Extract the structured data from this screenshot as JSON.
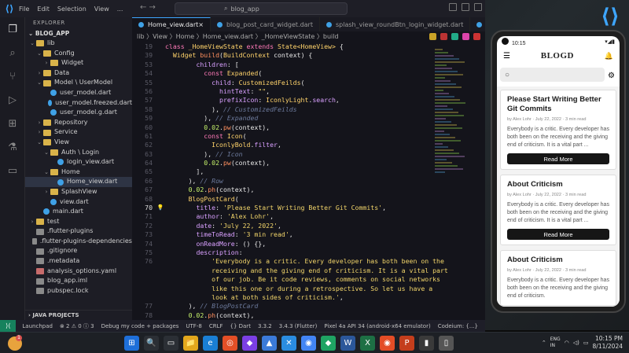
{
  "vscode": {
    "menu": [
      "File",
      "Edit",
      "Selection",
      "View",
      "..."
    ],
    "search_text": "blog_app",
    "explorer_title": "EXPLORER",
    "project": "BLOG_APP",
    "tree": [
      {
        "label": "lib",
        "depth": 0,
        "type": "fold",
        "open": true
      },
      {
        "label": "Config",
        "depth": 1,
        "type": "fold",
        "open": true
      },
      {
        "label": "Widget",
        "depth": 2,
        "type": "fold",
        "open": false
      },
      {
        "label": "Data",
        "depth": 1,
        "type": "fold",
        "open": false
      },
      {
        "label": "Model \\ UserModel",
        "depth": 1,
        "type": "fold",
        "open": true
      },
      {
        "label": "user_model.dart",
        "depth": 2,
        "type": "dart"
      },
      {
        "label": "user_model.freezed.dart",
        "depth": 2,
        "type": "dart"
      },
      {
        "label": "user_model.g.dart",
        "depth": 2,
        "type": "dart"
      },
      {
        "label": "Repository",
        "depth": 1,
        "type": "fold",
        "open": false
      },
      {
        "label": "Service",
        "depth": 1,
        "type": "fold",
        "open": false
      },
      {
        "label": "View",
        "depth": 1,
        "type": "fold",
        "open": true
      },
      {
        "label": "Auth \\ Login",
        "depth": 2,
        "type": "fold",
        "open": true
      },
      {
        "label": "login_view.dart",
        "depth": 3,
        "type": "dart"
      },
      {
        "label": "Home",
        "depth": 2,
        "type": "fold",
        "open": true
      },
      {
        "label": "Home_view.dart",
        "depth": 3,
        "type": "dart",
        "selected": true
      },
      {
        "label": "SplashView",
        "depth": 2,
        "type": "fold",
        "open": false
      },
      {
        "label": "view.dart",
        "depth": 2,
        "type": "dart"
      },
      {
        "label": "main.dart",
        "depth": 1,
        "type": "dart"
      },
      {
        "label": "test",
        "depth": 0,
        "type": "fold",
        "open": false
      },
      {
        "label": ".flutter-plugins",
        "depth": 0,
        "type": "misc"
      },
      {
        "label": ".flutter-plugins-dependencies",
        "depth": 0,
        "type": "misc"
      },
      {
        "label": ".gitignore",
        "depth": 0,
        "type": "misc"
      },
      {
        "label": ".metadata",
        "depth": 0,
        "type": "misc"
      },
      {
        "label": "analysis_options.yaml",
        "depth": 0,
        "type": "yaml"
      },
      {
        "label": "blog_app.iml",
        "depth": 0,
        "type": "misc"
      },
      {
        "label": "pubspec.lock",
        "depth": 0,
        "type": "misc"
      }
    ],
    "java_projects": "JAVA PROJECTS",
    "tabs": [
      "Home_view.dart",
      "blog_post_card_widget.dart",
      "splash_view_roundBtn_login_widget.dart",
      "spla"
    ],
    "breadcrumb": "lib 〉View 〉Home 〉Home_view.dart 〉_HomeViewState 〉build",
    "code": [
      {
        "n": "19",
        "segs": [
          [
            "k",
            "class "
          ],
          [
            "c",
            "_HomeViewState "
          ],
          [
            "k",
            "extends "
          ],
          [
            "c",
            "State<HomeView> "
          ],
          [
            "w",
            "{"
          ]
        ]
      },
      {
        "n": "39",
        "segs": [
          [
            "w",
            "  "
          ],
          [
            "c",
            "Widget "
          ],
          [
            "f",
            "build"
          ],
          [
            "w",
            "("
          ],
          [
            "c",
            "BuildContext "
          ],
          [
            "w",
            "context) {"
          ]
        ]
      },
      {
        "n": "53",
        "segs": [
          [
            "w",
            "        "
          ],
          [
            "p",
            "children"
          ],
          [
            "w",
            ": ["
          ]
        ]
      },
      {
        "n": "54",
        "segs": [
          [
            "w",
            "          "
          ],
          [
            "k",
            "const "
          ],
          [
            "c",
            "Expanded"
          ],
          [
            "w",
            "("
          ]
        ]
      },
      {
        "n": "55",
        "segs": [
          [
            "w",
            "            "
          ],
          [
            "p",
            "child"
          ],
          [
            "w",
            ": "
          ],
          [
            "c",
            "CustomizedFeilds"
          ],
          [
            "w",
            "("
          ]
        ]
      },
      {
        "n": "56",
        "segs": [
          [
            "w",
            "              "
          ],
          [
            "p",
            "hintText"
          ],
          [
            "w",
            ": "
          ],
          [
            "s",
            "\"\""
          ],
          [
            "w",
            ","
          ]
        ]
      },
      {
        "n": "57",
        "segs": [
          [
            "w",
            "              "
          ],
          [
            "p",
            "prefixIcon"
          ],
          [
            "w",
            ": "
          ],
          [
            "c",
            "IconlyLight"
          ],
          [
            "w",
            "."
          ],
          [
            "p",
            "search"
          ],
          [
            "w",
            ","
          ]
        ]
      },
      {
        "n": "58",
        "segs": [
          [
            "w",
            "            ), "
          ],
          [
            "cm",
            "// CustomizedFeilds"
          ]
        ]
      },
      {
        "n": "59",
        "segs": [
          [
            "w",
            "          ), "
          ],
          [
            "cm",
            "// Expanded"
          ]
        ]
      },
      {
        "n": "60",
        "segs": [
          [
            "w",
            "          "
          ],
          [
            "n",
            "0.02"
          ],
          [
            "w",
            "."
          ],
          [
            "f",
            "pw"
          ],
          [
            "w",
            "(context),"
          ]
        ]
      },
      {
        "n": "61",
        "segs": [
          [
            "w",
            "          "
          ],
          [
            "k",
            "const "
          ],
          [
            "c",
            "Icon"
          ],
          [
            "w",
            "("
          ]
        ]
      },
      {
        "n": "62",
        "segs": [
          [
            "w",
            "            "
          ],
          [
            "c",
            "IconlyBold"
          ],
          [
            "w",
            "."
          ],
          [
            "p",
            "filter"
          ],
          [
            "w",
            ","
          ]
        ]
      },
      {
        "n": "63",
        "segs": [
          [
            "w",
            "          ), "
          ],
          [
            "cm",
            "// Icon"
          ]
        ]
      },
      {
        "n": "64",
        "segs": [
          [
            "w",
            "          "
          ],
          [
            "n",
            "0.02"
          ],
          [
            "w",
            "."
          ],
          [
            "f",
            "pw"
          ],
          [
            "w",
            "(context),"
          ]
        ]
      },
      {
        "n": "65",
        "segs": [
          [
            "w",
            "        ],"
          ]
        ]
      },
      {
        "n": "66",
        "segs": [
          [
            "w",
            "      ), "
          ],
          [
            "cm",
            "// Row"
          ]
        ]
      },
      {
        "n": "67",
        "segs": [
          [
            "w",
            "      "
          ],
          [
            "n",
            "0.02"
          ],
          [
            "w",
            "."
          ],
          [
            "f",
            "ph"
          ],
          [
            "w",
            "(context),"
          ]
        ]
      },
      {
        "n": "68",
        "segs": [
          [
            "w",
            "      "
          ],
          [
            "c",
            "BlogPostCard"
          ],
          [
            "w",
            "("
          ]
        ]
      },
      {
        "n": "70",
        "segs": [
          [
            "w",
            "        "
          ],
          [
            "p",
            "title"
          ],
          [
            "w",
            ": "
          ],
          [
            "s",
            "'Please Start Writing Better Git Commits'"
          ],
          [
            "w",
            ","
          ]
        ],
        "cur": true
      },
      {
        "n": "71",
        "segs": [
          [
            "w",
            "        "
          ],
          [
            "p",
            "author"
          ],
          [
            "w",
            ": "
          ],
          [
            "s",
            "'Alex Lohr'"
          ],
          [
            "w",
            ","
          ]
        ]
      },
      {
        "n": "72",
        "segs": [
          [
            "w",
            "        "
          ],
          [
            "p",
            "date"
          ],
          [
            "w",
            ": "
          ],
          [
            "s",
            "'July 22, 2022'"
          ],
          [
            "w",
            ","
          ]
        ]
      },
      {
        "n": "73",
        "segs": [
          [
            "w",
            "        "
          ],
          [
            "p",
            "timeToRead"
          ],
          [
            "w",
            ": "
          ],
          [
            "s",
            "'3 min read'"
          ],
          [
            "w",
            ","
          ]
        ]
      },
      {
        "n": "74",
        "segs": [
          [
            "w",
            "        "
          ],
          [
            "p",
            "onReadMore"
          ],
          [
            "w",
            ": () {},"
          ]
        ]
      },
      {
        "n": "75",
        "segs": [
          [
            "w",
            "        "
          ],
          [
            "p",
            "description"
          ],
          [
            "w",
            ":"
          ]
        ]
      },
      {
        "n": "76",
        "segs": [
          [
            "s",
            "            'Everybody is a critic. Every developer has both been on the"
          ]
        ]
      },
      {
        "n": "",
        "segs": [
          [
            "s",
            "            receiving and the giving end of criticism. It is a vital part"
          ]
        ]
      },
      {
        "n": "",
        "segs": [
          [
            "s",
            "            of our job. Be it code reviews, comments on social networks"
          ]
        ]
      },
      {
        "n": "",
        "segs": [
          [
            "s",
            "            like this one or during a retrospective. So let us have a"
          ]
        ]
      },
      {
        "n": "",
        "segs": [
          [
            "s",
            "            look at both sides of criticism.'"
          ],
          [
            "w",
            ","
          ]
        ]
      },
      {
        "n": "77",
        "segs": [
          [
            "w",
            "      ), "
          ],
          [
            "cm",
            "// BlogPostCard"
          ]
        ]
      },
      {
        "n": "78",
        "segs": [
          [
            "w",
            "      "
          ],
          [
            "n",
            "0.02"
          ],
          [
            "w",
            "."
          ],
          [
            "f",
            "ph"
          ],
          [
            "w",
            "(context),"
          ]
        ]
      },
      {
        "n": "79",
        "segs": [
          [
            "w",
            "      "
          ],
          [
            "c",
            "BlogPostCard"
          ],
          [
            "w",
            "("
          ]
        ]
      }
    ],
    "status": [
      "Launchpad",
      "⊗ 2 ⚠ 0 ⓘ 3",
      "Debug my code + packages",
      "UTF-8",
      "CRLF",
      "{} Dart",
      "3.3.2",
      "3.4.3 (Flutter)",
      "Pixel 4a API 34 (android-x64 emulator)",
      "Codeium: {...}"
    ]
  },
  "phone": {
    "time": "10:15",
    "app_title": "BLOGD",
    "cards": [
      {
        "title": "Please Start Writing Better Git Commits",
        "meta": "by Alex Lohr · July 22, 2022 · 3 min read",
        "desc": "Everybody is a critic. Every developer has both been on the receiving and the giving end of criticism. It is a vital part ...",
        "button": "Read More"
      },
      {
        "title": "About Criticism",
        "meta": "by Alex Lohr · July 22, 2022 · 3 min read",
        "desc": "Everybody is a critic. Every developer has both been on the receiving and the giving end of criticism. It is a vital part ...",
        "button": "Read More"
      },
      {
        "title": "About Criticism",
        "meta": "by Alex Lohr · July 22, 2022 · 3 min read",
        "desc": "Everybody is a critic. Every developer has both been on the receiving and the giving end of criticism.",
        "button": ""
      }
    ]
  },
  "taskbar": {
    "notification_count": "1",
    "apps": [
      "⊞",
      "🔍",
      "▭",
      "📁",
      "e",
      "◎",
      "◆",
      "▲",
      "✕",
      "◉",
      "◆",
      "W",
      "X",
      "◉",
      "P",
      "▮",
      "▯"
    ],
    "time": "10:15 PM",
    "date": "8/11/2024",
    "lang": "ENG\nIN"
  }
}
